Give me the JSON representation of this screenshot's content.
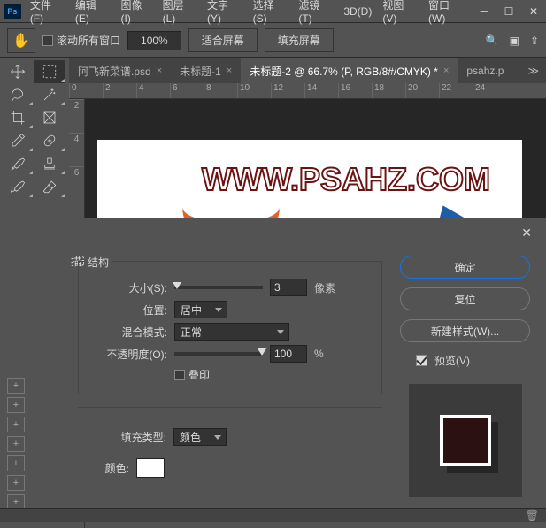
{
  "menu": {
    "file": "文件(F)",
    "edit": "编辑(E)",
    "image": "图像(I)",
    "layer": "图层(L)",
    "type": "文字(Y)",
    "select": "选择(S)",
    "filter": "滤镜(T)",
    "threeD": "3D(D)",
    "view": "视图(V)",
    "window": "窗口(W)"
  },
  "options": {
    "scroll_all_label": "滚动所有窗口",
    "zoom": "100%",
    "fit_screen": "适合屏幕",
    "fill_screen": "填充屏幕"
  },
  "tabs": {
    "t1": "阿飞新菜谱.psd",
    "t2": "未标题-1",
    "t3": "未标题-2 @ 66.7% (P, RGB/8#/CMYK) *",
    "t4": "psahz.p"
  },
  "ruler": {
    "h": [
      "0",
      "2",
      "4",
      "6",
      "8",
      "10",
      "12",
      "14",
      "16",
      "18",
      "20",
      "22",
      "24"
    ],
    "v": [
      "2",
      "4",
      "6"
    ]
  },
  "canvas": {
    "watermark": "WWW.PSAHZ.COM"
  },
  "dialog": {
    "stroke_title": "描边",
    "structure_legend": "结构",
    "size_label": "大小(S):",
    "size_value": "3",
    "size_unit": "像素",
    "position_label": "位置:",
    "position_value": "居中",
    "blend_label": "混合模式:",
    "blend_value": "正常",
    "opacity_label": "不透明度(O):",
    "opacity_value": "100",
    "opacity_unit": "%",
    "overprint_label": "叠印",
    "filltype_label": "填充类型:",
    "filltype_value": "颜色",
    "color_label": "颜色:",
    "ok": "确定",
    "reset": "复位",
    "new_style": "新建样式(W)...",
    "preview": "预览(V)"
  }
}
